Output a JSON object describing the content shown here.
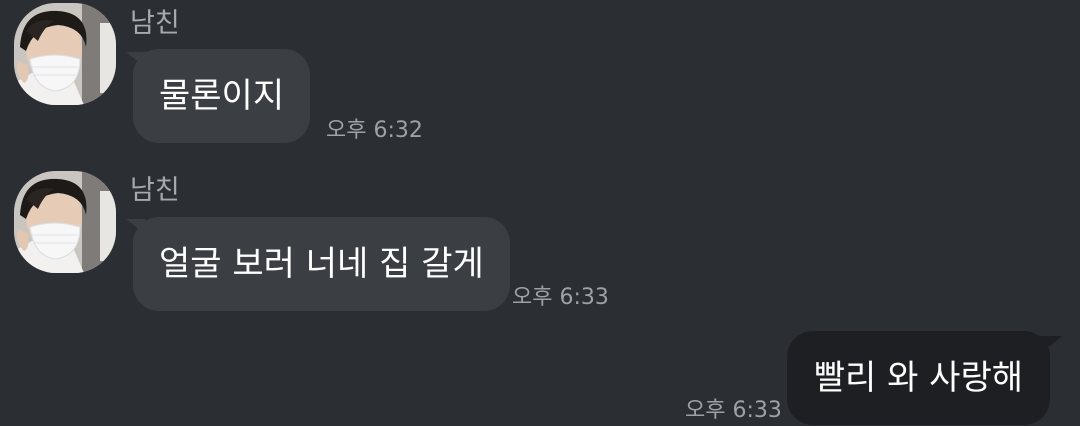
{
  "messages": [
    {
      "sender": "남친",
      "text": "물론이지",
      "time": "오후 6:32",
      "avatar_icon": "profile-photo-masked-person"
    },
    {
      "sender": "남친",
      "text": "얼굴 보러 너네 집 갈게",
      "time": "오후 6:33",
      "avatar_icon": "profile-photo-masked-person"
    },
    {
      "text": "빨리 와 사랑해",
      "time": "오후 6:33"
    }
  ],
  "colors": {
    "background": "#2b2e33",
    "incoming_bubble": "#3b3e43",
    "outgoing_bubble": "#1e1f22",
    "sender_name": "#a6a9ad",
    "timestamp": "#9ea1a5"
  }
}
